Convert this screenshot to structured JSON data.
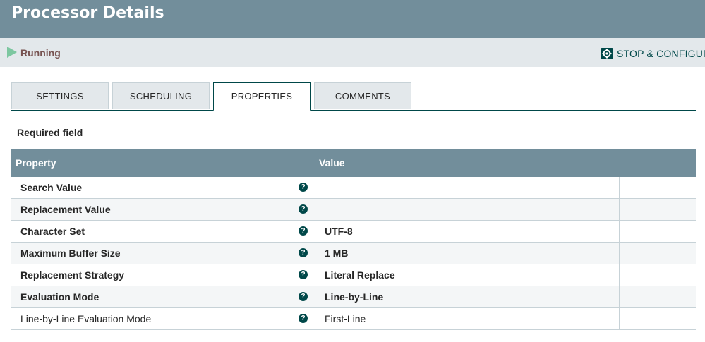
{
  "header": {
    "title": "Processor Details"
  },
  "status": {
    "text": "Running",
    "icon": "play-icon",
    "color": "#7dc7a0"
  },
  "toolbar": {
    "stop_configure_label": "STOP & CONFIGURE",
    "icon": "gear-icon"
  },
  "tabs": [
    {
      "label": "SETTINGS",
      "active": false
    },
    {
      "label": "SCHEDULING",
      "active": false
    },
    {
      "label": "PROPERTIES",
      "active": true
    },
    {
      "label": "COMMENTS",
      "active": false
    }
  ],
  "required_note": "Required field",
  "table": {
    "headers": [
      "Property",
      "Value"
    ],
    "rows": [
      {
        "name": "Search Value",
        "value": "",
        "required": true
      },
      {
        "name": "Replacement Value",
        "value": "_",
        "required": true
      },
      {
        "name": "Character Set",
        "value": "UTF-8",
        "required": true
      },
      {
        "name": "Maximum Buffer Size",
        "value": "1 MB",
        "required": true
      },
      {
        "name": "Replacement Strategy",
        "value": "Literal Replace",
        "required": true
      },
      {
        "name": "Evaluation Mode",
        "value": "Line-by-Line",
        "required": true
      },
      {
        "name": "Line-by-Line Evaluation Mode",
        "value": "First-Line",
        "required": false
      }
    ]
  },
  "colors": {
    "header_bg": "#728e9b",
    "statusbar_bg": "#e3e8eb",
    "accent": "#004849",
    "status_text": "#775351"
  }
}
